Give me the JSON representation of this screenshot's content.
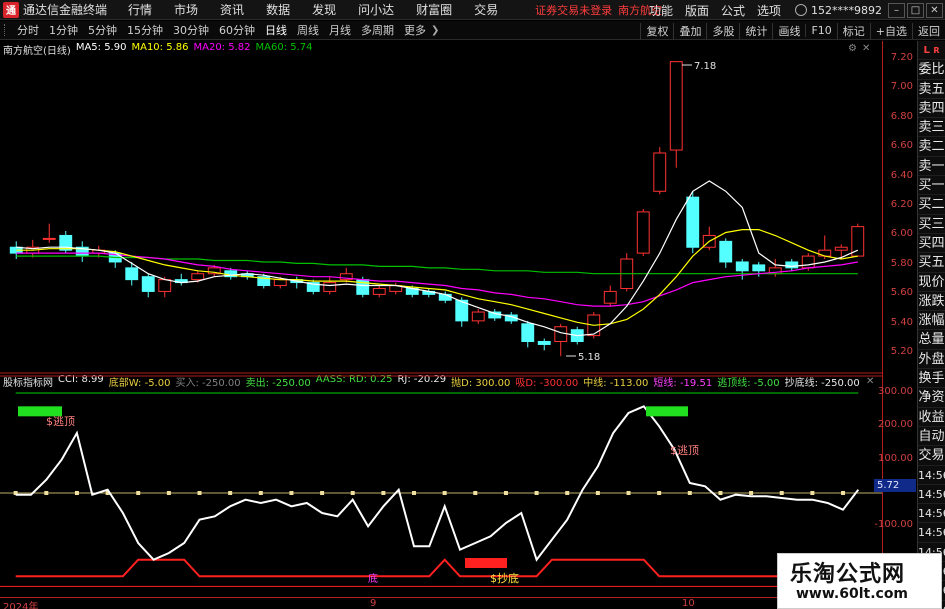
{
  "titlebar": {
    "app_title": "通达信金融终端",
    "menu": [
      "行情",
      "市场",
      "资讯",
      "数据",
      "发现",
      "问小达",
      "财富圈",
      "交易"
    ],
    "notice_text": "证券交易未登录",
    "stock_name": "南方航空",
    "right_menu": [
      "功能",
      "版面",
      "公式",
      "选项"
    ],
    "user_id": "152****9892"
  },
  "toolbar": {
    "periods": [
      "分时",
      "1分钟",
      "5分钟",
      "15分钟",
      "30分钟",
      "60分钟",
      "日线",
      "周线",
      "月线",
      "多周期",
      "更多"
    ],
    "active_period": "日线",
    "right_items": [
      "复权",
      "叠加",
      "多股",
      "统计",
      "画线",
      "F10",
      "标记",
      "+自选",
      "返回"
    ]
  },
  "main_legend": {
    "title": "南方航空(日线)",
    "ma5": "MA5: 5.90",
    "ma10": "MA10: 5.86",
    "ma20": "MA20: 5.82",
    "ma60": "MA60: 5.74"
  },
  "indicator_legend": {
    "name": "股标指标网",
    "items": [
      {
        "text": "CCI: 8.99",
        "color": "#e8e8e8"
      },
      {
        "text": "底部W: -5.00",
        "color": "#e8d040"
      },
      {
        "text": "买入: -250.00",
        "color": "#808080"
      },
      {
        "text": "卖出: -250.00",
        "color": "#40e040"
      },
      {
        "text": "AASS: RD: 0.25",
        "color": "#40e040"
      },
      {
        "text": "RJ: -20.29",
        "color": "#e8e8e8"
      },
      {
        "text": "抛D: 300.00",
        "color": "#e8d040"
      },
      {
        "text": "吸D: -300.00",
        "color": "#ff3030"
      },
      {
        "text": "中线: -113.00",
        "color": "#e8d040"
      },
      {
        "text": "短线: -19.51",
        "color": "#ff40ff"
      },
      {
        "text": "逃顶线: -5.00",
        "color": "#40e040"
      },
      {
        "text": "抄底线: -250.00",
        "color": "#e8e8e8"
      }
    ]
  },
  "price_scale": [
    "7.20",
    "7.00",
    "6.80",
    "6.60",
    "6.40",
    "6.20",
    "6.00",
    "5.80",
    "5.60",
    "5.40",
    "5.20"
  ],
  "indicator_scale": [
    "300.00",
    "200.00",
    "100.00",
    "-100.00",
    "-200.00"
  ],
  "current_value_badge": "5.72",
  "side_tabs": {
    "top": "L",
    "top_sub": "R",
    "items": [
      "委比",
      "卖五",
      "卖四",
      "卖三",
      "卖二",
      "卖一",
      "买一",
      "买二",
      "买三",
      "买四",
      "买五",
      "现价",
      "涨跌",
      "涨幅",
      "总量",
      "外盘",
      "换手",
      "净资",
      "收益",
      "自动",
      "交易"
    ],
    "times": [
      "14:56",
      "14:56",
      "14:56",
      "14:56",
      "14:56",
      "14:56",
      "14:56",
      "14:56"
    ]
  },
  "annotations": {
    "high": "7.18",
    "low": "5.18",
    "escape_top_1": "$逃顶",
    "escape_top_2": "$逃顶",
    "buy_bottom": "$抄底",
    "bottom_mark": "底"
  },
  "time_axis": [
    "2024年",
    "9",
    "10"
  ],
  "watermark": {
    "title": "乐淘公式网",
    "url": "www.60lt.com"
  },
  "colors": {
    "up": "#ff3232",
    "up_fill": "#000000",
    "down": "#54ffff",
    "ma5": "#ffffff",
    "ma10": "#ffff00",
    "ma20": "#ff00ff",
    "ma60": "#00c000",
    "cci": "#ffffff",
    "axis_red": "#b21d1d"
  },
  "chart_data": {
    "type": "candlestick",
    "y_range": [
      5.1,
      7.3
    ],
    "candles": [
      {
        "o": 5.92,
        "c": 5.88,
        "h": 5.96,
        "l": 5.84
      },
      {
        "o": 5.88,
        "c": 5.92,
        "h": 5.97,
        "l": 5.85
      },
      {
        "o": 5.98,
        "c": 5.98,
        "h": 6.08,
        "l": 5.95
      },
      {
        "o": 6.0,
        "c": 5.9,
        "h": 6.03,
        "l": 5.88
      },
      {
        "o": 5.92,
        "c": 5.86,
        "h": 5.96,
        "l": 5.82
      },
      {
        "o": 5.88,
        "c": 5.9,
        "h": 5.93,
        "l": 5.85
      },
      {
        "o": 5.88,
        "c": 5.82,
        "h": 5.9,
        "l": 5.78
      },
      {
        "o": 5.78,
        "c": 5.7,
        "h": 5.82,
        "l": 5.66
      },
      {
        "o": 5.72,
        "c": 5.62,
        "h": 5.74,
        "l": 5.58
      },
      {
        "o": 5.62,
        "c": 5.7,
        "h": 5.72,
        "l": 5.58
      },
      {
        "o": 5.7,
        "c": 5.68,
        "h": 5.74,
        "l": 5.66
      },
      {
        "o": 5.7,
        "c": 5.74,
        "h": 5.76,
        "l": 5.68
      },
      {
        "o": 5.74,
        "c": 5.78,
        "h": 5.8,
        "l": 5.72
      },
      {
        "o": 5.76,
        "c": 5.72,
        "h": 5.78,
        "l": 5.7
      },
      {
        "o": 5.74,
        "c": 5.72,
        "h": 5.76,
        "l": 5.7
      },
      {
        "o": 5.72,
        "c": 5.66,
        "h": 5.74,
        "l": 5.64
      },
      {
        "o": 5.66,
        "c": 5.7,
        "h": 5.72,
        "l": 5.64
      },
      {
        "o": 5.7,
        "c": 5.68,
        "h": 5.72,
        "l": 5.64
      },
      {
        "o": 5.68,
        "c": 5.62,
        "h": 5.7,
        "l": 5.6
      },
      {
        "o": 5.62,
        "c": 5.68,
        "h": 5.72,
        "l": 5.6
      },
      {
        "o": 5.7,
        "c": 5.74,
        "h": 5.78,
        "l": 5.68
      },
      {
        "o": 5.7,
        "c": 5.6,
        "h": 5.72,
        "l": 5.58
      },
      {
        "o": 5.6,
        "c": 5.64,
        "h": 5.66,
        "l": 5.58
      },
      {
        "o": 5.62,
        "c": 5.66,
        "h": 5.68,
        "l": 5.6
      },
      {
        "o": 5.64,
        "c": 5.6,
        "h": 5.66,
        "l": 5.58
      },
      {
        "o": 5.62,
        "c": 5.6,
        "h": 5.64,
        "l": 5.58
      },
      {
        "o": 5.6,
        "c": 5.56,
        "h": 5.62,
        "l": 5.54
      },
      {
        "o": 5.56,
        "c": 5.42,
        "h": 5.58,
        "l": 5.38
      },
      {
        "o": 5.42,
        "c": 5.48,
        "h": 5.5,
        "l": 5.4
      },
      {
        "o": 5.48,
        "c": 5.44,
        "h": 5.5,
        "l": 5.42
      },
      {
        "o": 5.46,
        "c": 5.42,
        "h": 5.48,
        "l": 5.4
      },
      {
        "o": 5.4,
        "c": 5.28,
        "h": 5.42,
        "l": 5.24
      },
      {
        "o": 5.28,
        "c": 5.26,
        "h": 5.3,
        "l": 5.22
      },
      {
        "o": 5.28,
        "c": 5.38,
        "h": 5.4,
        "l": 5.18
      },
      {
        "o": 5.36,
        "c": 5.28,
        "h": 5.38,
        "l": 5.26
      },
      {
        "o": 5.32,
        "c": 5.46,
        "h": 5.48,
        "l": 5.3
      },
      {
        "o": 5.54,
        "c": 5.62,
        "h": 5.66,
        "l": 5.52
      },
      {
        "o": 5.64,
        "c": 5.84,
        "h": 5.88,
        "l": 5.62
      },
      {
        "o": 5.88,
        "c": 6.16,
        "h": 6.18,
        "l": 5.86
      },
      {
        "o": 6.3,
        "c": 6.56,
        "h": 6.6,
        "l": 6.28
      },
      {
        "o": 6.58,
        "c": 7.18,
        "h": 7.18,
        "l": 6.46
      },
      {
        "o": 6.26,
        "c": 5.92,
        "h": 6.3,
        "l": 5.88
      },
      {
        "o": 5.92,
        "c": 6.0,
        "h": 6.06,
        "l": 5.9
      },
      {
        "o": 5.96,
        "c": 5.82,
        "h": 5.98,
        "l": 5.78
      },
      {
        "o": 5.82,
        "c": 5.76,
        "h": 5.84,
        "l": 5.7
      },
      {
        "o": 5.8,
        "c": 5.76,
        "h": 5.82,
        "l": 5.72
      },
      {
        "o": 5.74,
        "c": 5.78,
        "h": 5.84,
        "l": 5.72
      },
      {
        "o": 5.82,
        "c": 5.78,
        "h": 5.84,
        "l": 5.76
      },
      {
        "o": 5.78,
        "c": 5.86,
        "h": 5.88,
        "l": 5.76
      },
      {
        "o": 5.86,
        "c": 5.9,
        "h": 6.0,
        "l": 5.84
      },
      {
        "o": 5.9,
        "c": 5.92,
        "h": 5.94,
        "l": 5.84
      },
      {
        "o": 5.86,
        "c": 6.06,
        "h": 6.08,
        "l": 5.86
      }
    ],
    "ma5": [
      5.92,
      5.91,
      5.92,
      5.92,
      5.91,
      5.9,
      5.88,
      5.81,
      5.74,
      5.7,
      5.68,
      5.69,
      5.72,
      5.73,
      5.74,
      5.73,
      5.71,
      5.69,
      5.67,
      5.66,
      5.67,
      5.66,
      5.66,
      5.66,
      5.64,
      5.62,
      5.6,
      5.55,
      5.51,
      5.47,
      5.45,
      5.41,
      5.38,
      5.34,
      5.32,
      5.33,
      5.4,
      5.52,
      5.69,
      5.88,
      6.11,
      6.3,
      6.37,
      6.3,
      6.19,
      5.88,
      5.8,
      5.79,
      5.8,
      5.82,
      5.85,
      5.9
    ],
    "ma10": [
      5.9,
      5.9,
      5.91,
      5.91,
      5.91,
      5.9,
      5.89,
      5.86,
      5.83,
      5.8,
      5.78,
      5.76,
      5.75,
      5.73,
      5.72,
      5.71,
      5.7,
      5.7,
      5.69,
      5.69,
      5.69,
      5.68,
      5.67,
      5.66,
      5.65,
      5.64,
      5.63,
      5.6,
      5.57,
      5.55,
      5.53,
      5.5,
      5.47,
      5.44,
      5.41,
      5.39,
      5.4,
      5.43,
      5.5,
      5.6,
      5.72,
      5.86,
      5.96,
      6.02,
      6.04,
      6.04,
      6.0,
      5.95,
      5.9,
      5.86,
      5.84,
      5.86
    ],
    "ma20": [
      5.88,
      5.88,
      5.88,
      5.88,
      5.88,
      5.88,
      5.87,
      5.86,
      5.85,
      5.84,
      5.82,
      5.8,
      5.79,
      5.77,
      5.76,
      5.75,
      5.74,
      5.73,
      5.72,
      5.72,
      5.71,
      5.7,
      5.69,
      5.69,
      5.68,
      5.67,
      5.66,
      5.64,
      5.63,
      5.61,
      5.6,
      5.58,
      5.57,
      5.55,
      5.53,
      5.52,
      5.52,
      5.53,
      5.55,
      5.59,
      5.63,
      5.68,
      5.7,
      5.72,
      5.73,
      5.74,
      5.75,
      5.76,
      5.78,
      5.79,
      5.8,
      5.82
    ],
    "ma60": [
      5.86,
      5.86,
      5.86,
      5.86,
      5.86,
      5.86,
      5.85,
      5.85,
      5.85,
      5.84,
      5.84,
      5.84,
      5.83,
      5.83,
      5.83,
      5.82,
      5.82,
      5.81,
      5.81,
      5.8,
      5.8,
      5.8,
      5.79,
      5.79,
      5.79,
      5.78,
      5.78,
      5.77,
      5.77,
      5.76,
      5.76,
      5.76,
      5.75,
      5.75,
      5.75,
      5.74,
      5.74,
      5.74,
      5.74,
      5.74,
      5.74,
      5.74,
      5.74,
      5.74,
      5.74,
      5.74,
      5.74,
      5.74,
      5.74,
      5.74,
      5.74,
      5.74
    ],
    "cci_range": [
      -300,
      300
    ],
    "cci": [
      -5,
      -5,
      40,
      100,
      180,
      -5,
      10,
      -60,
      -150,
      -200,
      -180,
      -150,
      -80,
      -70,
      -40,
      -20,
      -30,
      -20,
      -40,
      -30,
      -60,
      -70,
      -20,
      -100,
      -40,
      10,
      -160,
      -160,
      -40,
      -170,
      -150,
      -130,
      -90,
      -60,
      -200,
      -140,
      -80,
      10,
      80,
      180,
      240,
      260,
      200,
      130,
      30,
      20,
      -20,
      -5,
      -10,
      -10,
      -15,
      -20,
      -20,
      -30,
      -50,
      10
    ],
    "top_band": [
      300,
      300,
      300,
      300,
      300,
      300,
      300,
      300,
      300,
      300,
      300,
      300,
      300,
      300,
      300,
      300,
      300,
      300,
      300,
      300,
      300,
      300,
      300,
      300,
      300,
      300,
      300,
      300,
      300,
      300,
      300,
      300,
      300,
      300,
      300,
      300,
      300,
      300,
      300,
      300,
      300,
      300,
      300,
      300,
      300,
      300,
      300,
      300,
      300,
      300,
      300,
      300,
      300,
      300,
      300,
      300
    ],
    "bottom_step": [
      -250,
      -250,
      -250,
      -250,
      -250,
      -250,
      -250,
      -250,
      -200,
      -200,
      -200,
      -200,
      -250,
      -250,
      -250,
      -250,
      -250,
      -250,
      -250,
      -250,
      -250,
      -250,
      -250,
      -250,
      -250,
      -250,
      -250,
      -250,
      -200,
      -250,
      -250,
      -250,
      -250,
      -250,
      -250,
      -200,
      -200,
      -200,
      -200,
      -200,
      -200,
      -200,
      -250,
      -250,
      -250,
      -250,
      -250,
      -250,
      -250,
      -250,
      -250,
      -250,
      -250,
      -250,
      -250,
      -250
    ]
  }
}
